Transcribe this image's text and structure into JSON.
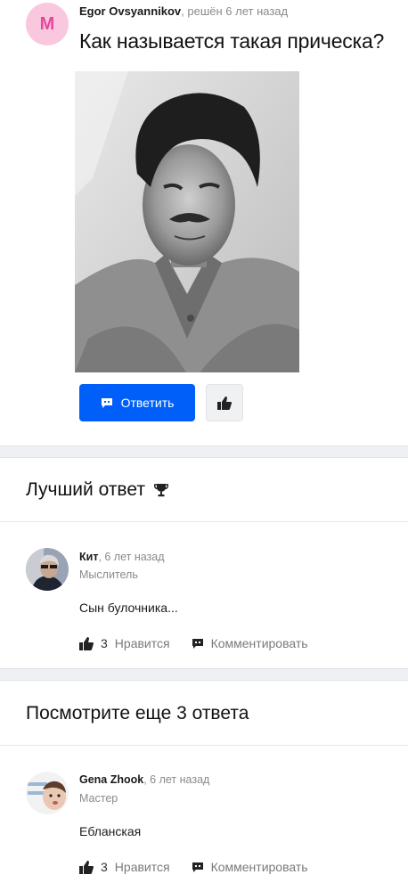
{
  "question": {
    "avatar_letter": "M",
    "author": "Egor Ovsyannikov",
    "status": ", решён 6 лет назад",
    "title": "Как называется такая прическа?",
    "answer_button": "Ответить"
  },
  "best_answer": {
    "heading": "Лучший ответ",
    "author": "Кит",
    "when": ", 6 лет назад",
    "rank": "Мыслитель",
    "text": "Сын булочника...",
    "likes": "3",
    "like_label": "Нравится",
    "comment_label": "Комментировать"
  },
  "more_answers": {
    "heading": "Посмотрите еще 3 ответа",
    "items": [
      {
        "author": "Gena Zhook",
        "when": ", 6 лет назад",
        "rank": "Мастер",
        "text": "Ебланская",
        "likes": "3",
        "like_label": "Нравится",
        "comment_label": "Комментировать"
      }
    ]
  }
}
